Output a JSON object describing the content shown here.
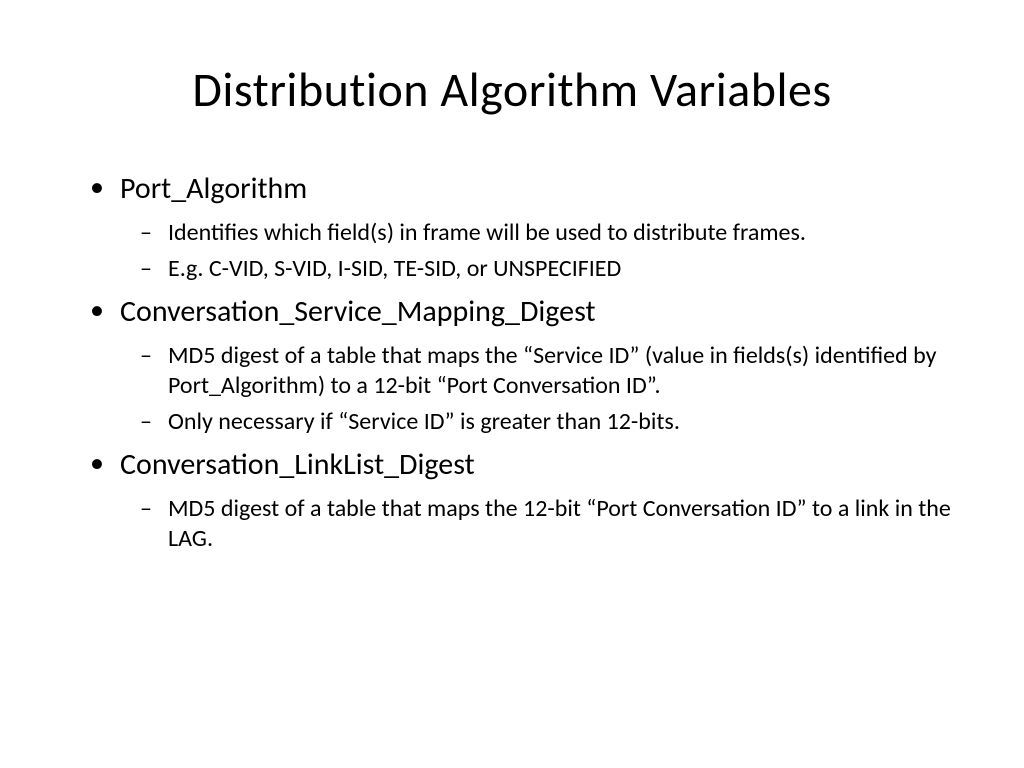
{
  "title": "Distribution Algorithm Variables",
  "items": [
    {
      "label": "Port_Algorithm",
      "subitems": [
        "Identifies which field(s) in frame will be used to distribute frames.",
        "E.g. C-VID, S-VID, I-SID, TE-SID, or UNSPECIFIED"
      ]
    },
    {
      "label": "Conversation_Service_Mapping_Digest",
      "subitems": [
        "MD5 digest of a table that maps the “Service ID” (value in fields(s) identified by Port_Algorithm) to a 12-bit “Port Conversation ID”.",
        "Only necessary if “Service ID” is greater than 12-bits."
      ]
    },
    {
      "label": "Conversation_LinkList_Digest",
      "subitems": [
        "MD5 digest of a table that maps the 12-bit “Port Conversation ID” to a link in the LAG."
      ]
    }
  ]
}
